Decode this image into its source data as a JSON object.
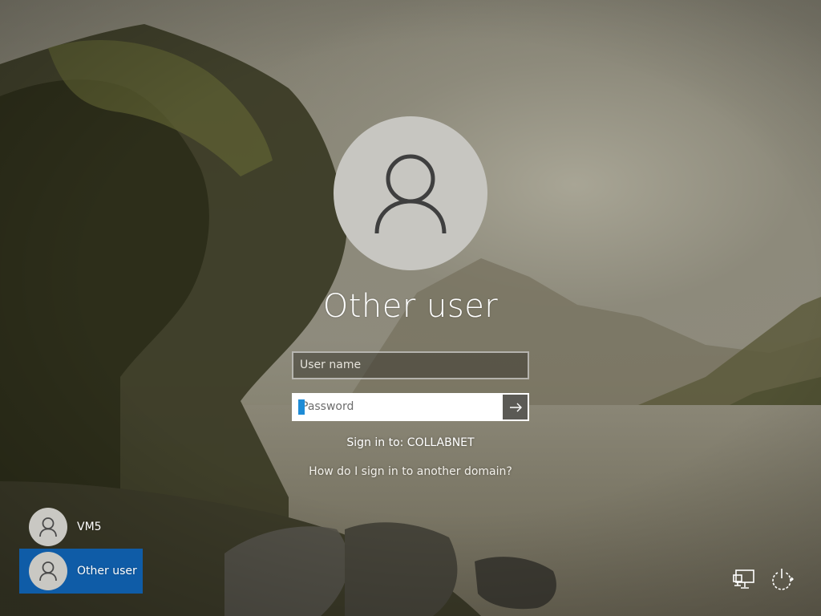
{
  "signin": {
    "display_name": "Other user",
    "username_placeholder": "User name",
    "password_placeholder": "Password",
    "signin_to": "Sign in to: COLLABNET",
    "help_link": "How do I sign in to another domain?",
    "submit_icon": "arrow-right-icon"
  },
  "user_switcher": {
    "users": [
      {
        "label": "VM5",
        "icon": "user-icon",
        "selected": false
      },
      {
        "label": "Other user",
        "icon": "user-icon",
        "selected": true
      }
    ]
  },
  "system_buttons": [
    {
      "name": "network",
      "icon": "network-icon"
    },
    {
      "name": "power",
      "icon": "power-icon"
    }
  ],
  "colors": {
    "selected_tile": "#0f5ca7",
    "caret": "#1e8cd6",
    "avatar_bg": "#c7c6c1"
  }
}
